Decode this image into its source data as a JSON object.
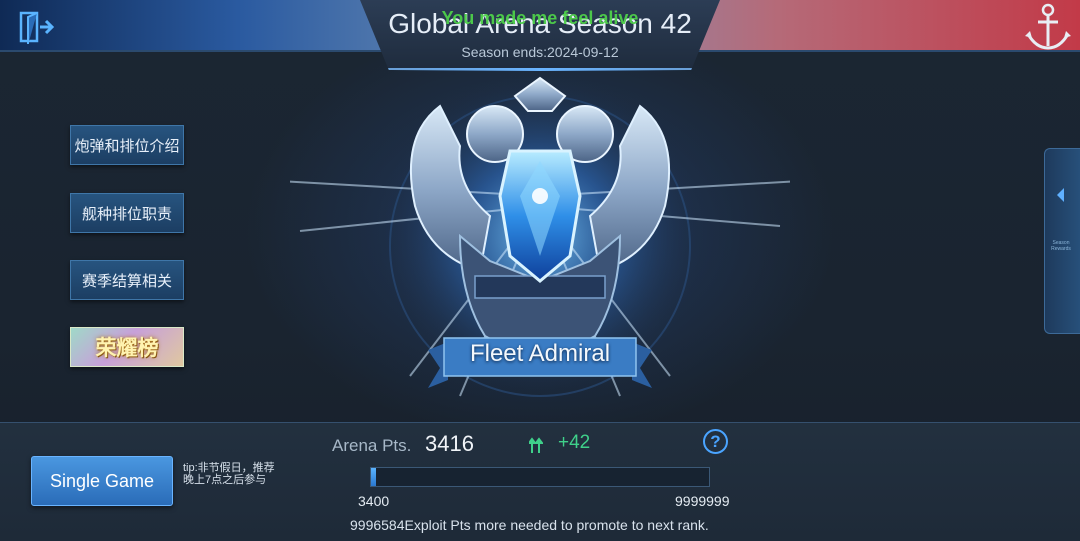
{
  "header": {
    "title": "Global Arena  Season 42",
    "season_ends": "Season ends:2024-09-12",
    "overlay_text": "You made me feel alive"
  },
  "side_menu": {
    "items": [
      {
        "label": "炮弹和排位介绍"
      },
      {
        "label": "舰种排位职责"
      },
      {
        "label": "赛季结算相关"
      },
      {
        "label": "荣耀榜"
      }
    ]
  },
  "right_tab": {
    "label": "Season Rewards"
  },
  "rank": {
    "name": "Fleet Admiral"
  },
  "arena": {
    "pts_label": "Arena Pts.",
    "pts_value": "3416",
    "gain": "+42",
    "progress_fraction": 0.0,
    "range_min": "3400",
    "range_max": "9999999",
    "promote_message": "9996584Exploit Pts more needed to promote to next rank."
  },
  "bottom": {
    "single_game_label": "Single Game",
    "tip": "tip:非节假日，推荐晚上7点之后参与",
    "help_label": "?"
  },
  "colors": {
    "accent": "#4aa4ff",
    "gain": "#3fd08a",
    "overlay": "#4ed04a"
  },
  "icons": {
    "exit": "exit-door-icon",
    "anchor": "anchor-icon",
    "up": "rank-up-icon",
    "help": "help-icon"
  }
}
